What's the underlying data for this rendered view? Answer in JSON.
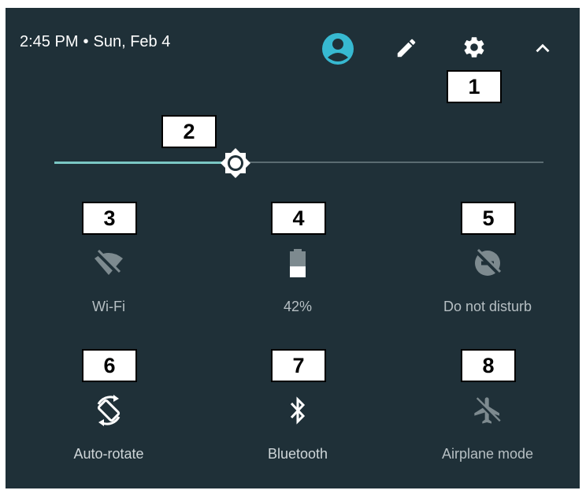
{
  "status": {
    "time": "2:45 PM",
    "separator": "•",
    "date": "Sun, Feb 4"
  },
  "header_icons": [
    "account-icon",
    "edit-icon",
    "settings-icon",
    "collapse-icon"
  ],
  "brightness": {
    "level": 0.37
  },
  "callouts": [
    "1",
    "2",
    "3",
    "4",
    "5",
    "6",
    "7",
    "8"
  ],
  "tiles": [
    {
      "label": "Wi-Fi",
      "icon": "wifi-off-icon",
      "state": "off"
    },
    {
      "label": "42%",
      "icon": "battery-icon",
      "state": "off"
    },
    {
      "label": "Do not disturb",
      "icon": "do-not-disturb-off-icon",
      "state": "off"
    },
    {
      "label": "Auto-rotate",
      "icon": "auto-rotate-icon",
      "state": "on"
    },
    {
      "label": "Bluetooth",
      "icon": "bluetooth-icon",
      "state": "on"
    },
    {
      "label": "Airplane mode",
      "icon": "airplane-icon",
      "state": "off"
    }
  ],
  "colors": {
    "panel": "#1f3038",
    "accent": "#37b9d1",
    "slider_active": "#7ac7c4",
    "icon_off": "#7d8a8f"
  }
}
